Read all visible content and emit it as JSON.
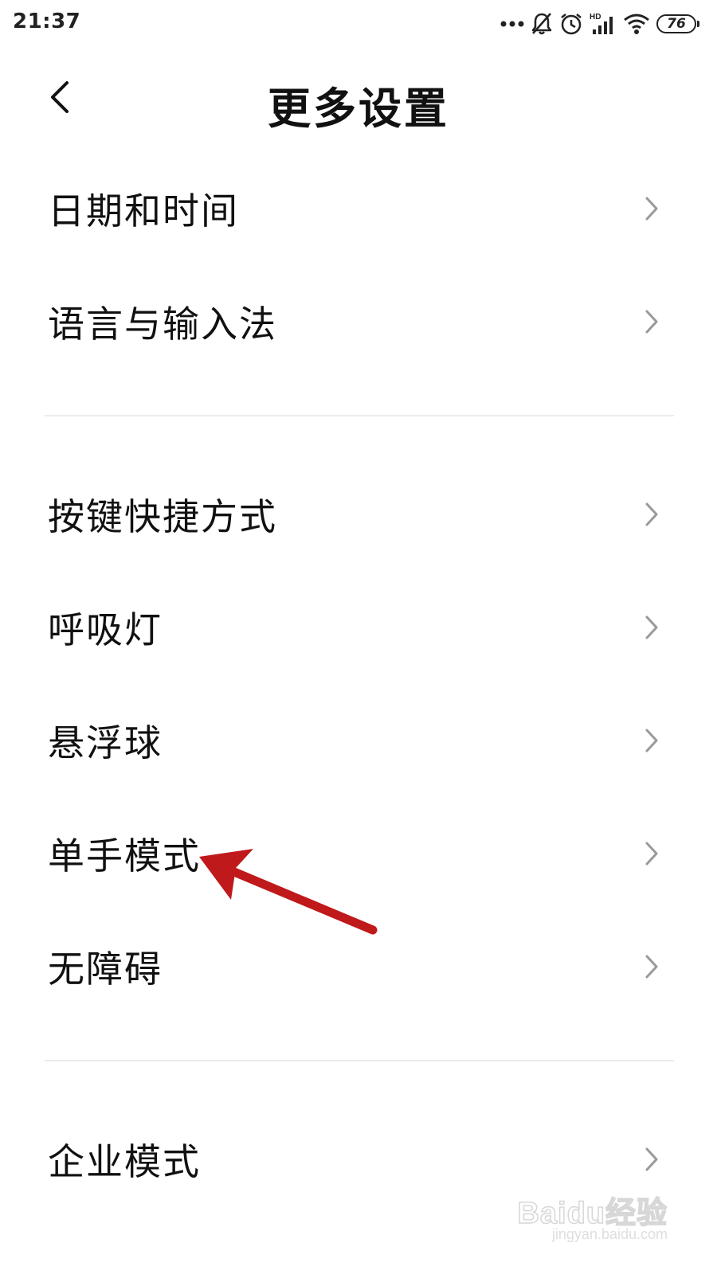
{
  "status_bar": {
    "time": "21:37",
    "battery": "76",
    "icons": [
      "more-dots-icon",
      "bell-off-icon",
      "alarm-icon",
      "hd-signal-icon",
      "wifi-icon",
      "battery-icon"
    ]
  },
  "header": {
    "title": "更多设置",
    "back_icon": "back-arrow-icon"
  },
  "settings": {
    "items": [
      {
        "label": "日期和时间"
      },
      {
        "label": "语言与输入法"
      },
      {
        "label": "按键快捷方式"
      },
      {
        "label": "呼吸灯"
      },
      {
        "label": "悬浮球"
      },
      {
        "label": "单手模式"
      },
      {
        "label": "无障碍"
      },
      {
        "label": "企业模式"
      }
    ]
  },
  "annotation": {
    "color": "#c0191b",
    "target_item": "单手模式"
  },
  "watermark": {
    "brand": "Baidu经验",
    "url": "jingyan.baidu.com"
  }
}
